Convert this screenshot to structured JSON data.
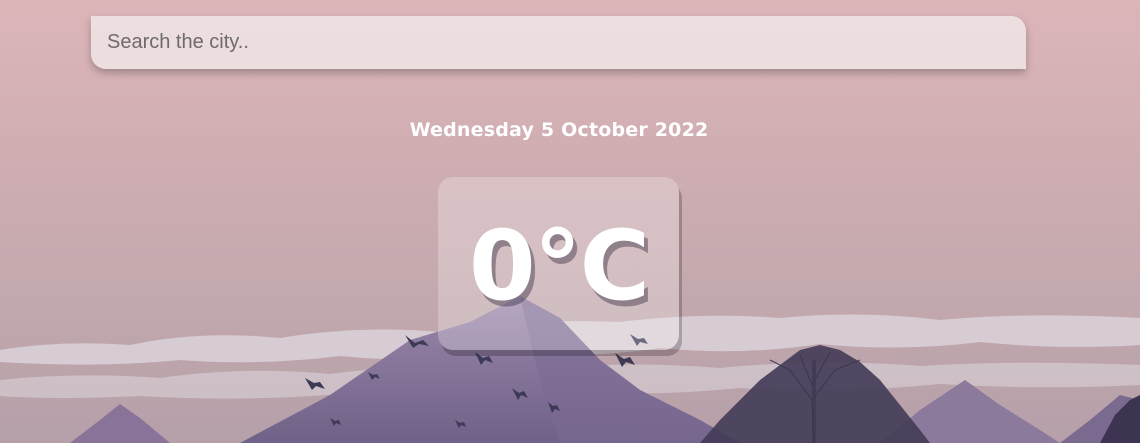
{
  "search": {
    "placeholder": "Search the city..",
    "value": ""
  },
  "weather": {
    "date": "Wednesday 5 October 2022",
    "temperature": "0°C"
  },
  "colors": {
    "sky_top": "#dcb4b8",
    "sky_bottom": "#b49aa6",
    "mountain": "#8a7599",
    "mountain_light": "#a58aa8",
    "cloud": "#e4dde2",
    "bird": "#3d3a55",
    "tree": "#3b3550"
  }
}
